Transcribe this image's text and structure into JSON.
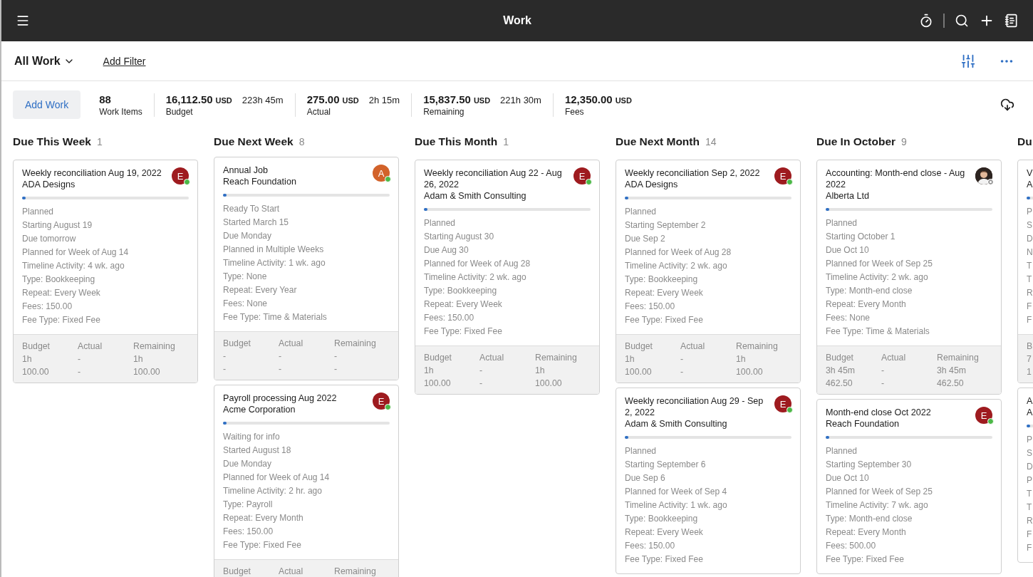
{
  "window": {
    "title": "Work"
  },
  "filter_bar": {
    "view": "All Work",
    "add_filter": "Add Filter"
  },
  "summary": {
    "add_button": "Add Work",
    "stats": [
      {
        "value": "88",
        "label": "Work Items"
      },
      {
        "value": "16,112.50",
        "unit": "USD",
        "hours": "223h 45m",
        "label": "Budget"
      },
      {
        "value": "275.00",
        "unit": "USD",
        "hours": "2h 15m",
        "label": "Actual"
      },
      {
        "value": "15,837.50",
        "unit": "USD",
        "hours": "221h 30m",
        "label": "Remaining"
      },
      {
        "value": "12,350.00",
        "unit": "USD",
        "label": "Fees"
      }
    ]
  },
  "columns": [
    {
      "title": "Due This Week",
      "count": "1",
      "cards": [
        {
          "title": "Weekly reconciliation Aug 19, 2022",
          "client": "ADA Designs",
          "avatar": {
            "kind": "initial",
            "initial": "E",
            "color": "#9e1b1f",
            "online": true
          },
          "level": 0.02,
          "details": [
            "Planned",
            "Starting August 19",
            "Due tomorrow",
            "Planned for Week of Aug 14",
            "Timeline Activity: 4 wk. ago",
            "Type: Bookkeeping",
            "Repeat: Every Week",
            "Fees: 150.00",
            "Fee Type: Fixed Fee"
          ],
          "footer": [
            {
              "label": "Budget",
              "values": [
                "1h",
                "100.00"
              ]
            },
            {
              "label": "Actual",
              "values": [
                "-",
                "-"
              ]
            },
            {
              "label": "Remaining",
              "values": [
                "1h",
                "100.00"
              ]
            }
          ]
        }
      ]
    },
    {
      "title": "Due Next Week",
      "count": "8",
      "cards": [
        {
          "title": "Annual Job",
          "client": "Reach Foundation",
          "avatar": {
            "kind": "initial",
            "initial": "A",
            "color": "#d2622a",
            "online": true
          },
          "level": 0.02,
          "details": [
            "Ready To Start",
            "Started March 15",
            "Due Monday",
            "Planned in Multiple Weeks",
            "Timeline Activity: 1 wk. ago",
            "Type: None",
            "Repeat: Every Year",
            "Fees: None",
            "Fee Type: Time & Materials"
          ],
          "footer": [
            {
              "label": "Budget",
              "values": [
                "-",
                "-"
              ]
            },
            {
              "label": "Actual",
              "values": [
                "-",
                "-"
              ]
            },
            {
              "label": "Remaining",
              "values": [
                "-",
                "-"
              ]
            }
          ]
        },
        {
          "title": "Payroll processing Aug 2022",
          "client": "Acme Corporation",
          "avatar": {
            "kind": "initial",
            "initial": "E",
            "color": "#9e1b1f",
            "online": true
          },
          "level": 0.02,
          "details": [
            "Waiting for info",
            "Started August 18",
            "Due Monday",
            "Planned for Week of Aug 14",
            "Timeline Activity: 2 hr. ago",
            "Type: Payroll",
            "Repeat: Every Month",
            "Fees: 150.00",
            "Fee Type: Fixed Fee"
          ],
          "footer": [
            {
              "label": "Budget"
            },
            {
              "label": "Actual"
            },
            {
              "label": "Remaining"
            }
          ]
        }
      ]
    },
    {
      "title": "Due This Month",
      "count": "1",
      "cards": [
        {
          "title": "Weekly reconciliation Aug 22 - Aug 26, 2022",
          "client": "Adam & Smith Consulting",
          "avatar": {
            "kind": "initial",
            "initial": "E",
            "color": "#9e1b1f",
            "online": true
          },
          "level": 0.02,
          "details": [
            "Planned",
            "Starting August 30",
            "Due Aug 30",
            "Planned for Week of Aug 28",
            "Timeline Activity: 2 wk. ago",
            "Type: Bookkeeping",
            "Repeat: Every Week",
            "Fees: 150.00",
            "Fee Type: Fixed Fee"
          ],
          "footer": [
            {
              "label": "Budget",
              "values": [
                "1h",
                "100.00"
              ]
            },
            {
              "label": "Actual",
              "values": [
                "-",
                "-"
              ]
            },
            {
              "label": "Remaining",
              "values": [
                "1h",
                "100.00"
              ]
            }
          ]
        }
      ]
    },
    {
      "title": "Due Next Month",
      "count": "14",
      "cards": [
        {
          "title": "Weekly reconciliation Sep 2, 2022",
          "client": "ADA Designs",
          "avatar": {
            "kind": "initial",
            "initial": "E",
            "color": "#9e1b1f",
            "online": true
          },
          "level": 0.02,
          "details": [
            "Planned",
            "Starting September 2",
            "Due Sep 2",
            "Planned for Week of Aug 28",
            "Timeline Activity: 2 wk. ago",
            "Type: Bookkeeping",
            "Repeat: Every Week",
            "Fees: 150.00",
            "Fee Type: Fixed Fee"
          ],
          "footer": [
            {
              "label": "Budget",
              "values": [
                "1h",
                "100.00"
              ]
            },
            {
              "label": "Actual",
              "values": [
                "-",
                "-"
              ]
            },
            {
              "label": "Remaining",
              "values": [
                "1h",
                "100.00"
              ]
            }
          ]
        },
        {
          "title": "Weekly reconciliation Aug 29 - Sep 2, 2022",
          "client": "Adam & Smith Consulting",
          "avatar": {
            "kind": "initial",
            "initial": "E",
            "color": "#9e1b1f",
            "online": true
          },
          "level": 0.02,
          "details": [
            "Planned",
            "Starting September 6",
            "Due Sep 6",
            "Planned for Week of Sep 4",
            "Timeline Activity: 1 wk. ago",
            "Type: Bookkeeping",
            "Repeat: Every Week",
            "Fees: 150.00",
            "Fee Type: Fixed Fee"
          ]
        }
      ]
    },
    {
      "title": "Due In October",
      "count": "9",
      "cards": [
        {
          "title": "Accounting: Month-end close - Aug 2022",
          "client": "Alberta Ltd",
          "level": 0.02,
          "details": [
            "Planned",
            "Starting October 1",
            "Due Oct 10",
            "Planned for Week of Sep 25",
            "Timeline Activity: 2 wk. ago",
            "Type: Month-end close",
            "Repeat: Every Month",
            "Fees: None",
            "Fee Type: Time & Materials"
          ],
          "footer": [
            {
              "label": "Budget",
              "values": [
                "3h 45m",
                "462.50"
              ]
            },
            {
              "label": "Actual",
              "values": [
                "-",
                "-"
              ]
            },
            {
              "label": "Remaining",
              "values": [
                "3h 45m",
                "462.50"
              ]
            }
          ]
        },
        {
          "title": "Month-end close Oct 2022",
          "client": "Reach Foundation",
          "avatar": {
            "kind": "initial",
            "initial": "E",
            "color": "#9e1b1f",
            "online": true
          },
          "level": 0.02,
          "details": [
            "Planned",
            "Starting September 30",
            "Due Oct 10",
            "Planned for Week of Sep 25",
            "Timeline Activity: 7 wk. ago",
            "Type: Month-end close",
            "Repeat: Every Month",
            "Fees: 500.00",
            "Fee Type: Fixed Fee"
          ]
        }
      ]
    },
    {
      "title": "Du",
      "cards": [
        {
          "title": "V",
          "client": "A",
          "level": 0.02,
          "details": [
            "P",
            "S",
            "D",
            "N",
            "T",
            "T",
            "R",
            "F",
            "F"
          ],
          "footer": [
            {
              "label": "B",
              "values": [
                "7",
                "1"
              ]
            }
          ]
        },
        {
          "title": "A",
          "client": "A",
          "level": 0.02,
          "details": [
            "P",
            "S",
            "D",
            "P",
            "T",
            "T",
            "R",
            "F",
            "F"
          ]
        }
      ]
    }
  ]
}
